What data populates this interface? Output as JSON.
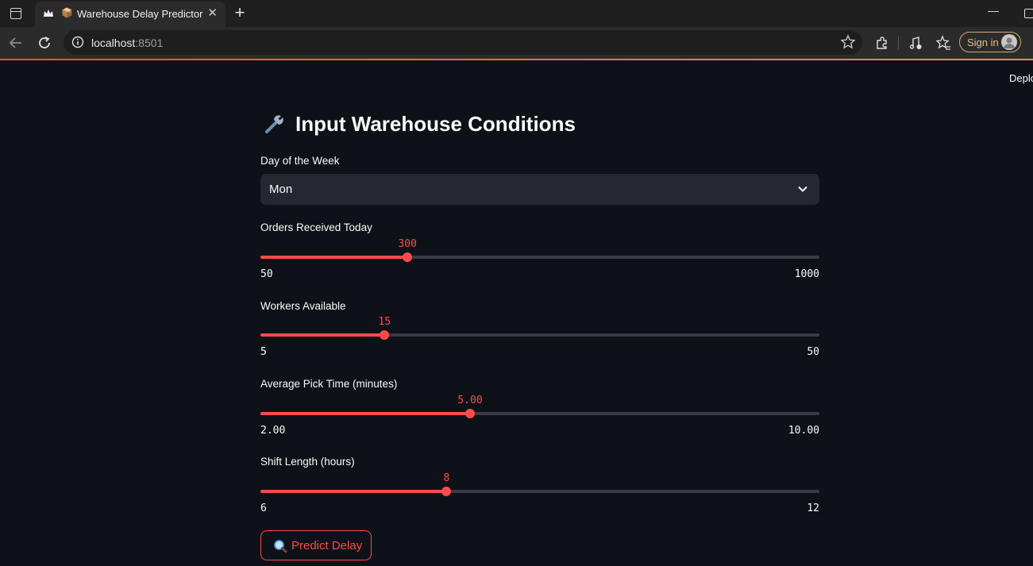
{
  "browser": {
    "tab_title": "Warehouse Delay Predictor",
    "tab_emoji": "📦",
    "url_host": "localhost",
    "url_port": ":8501",
    "signin_label": "Sign in"
  },
  "app": {
    "deploy_label": "Deplo",
    "title": "Input Warehouse Conditions",
    "title_icon": "wrench-icon",
    "accent_color": "#ff4b4b",
    "day_select": {
      "label": "Day of the Week",
      "value": "Mon"
    },
    "sliders": [
      {
        "label": "Orders Received Today",
        "value": "300",
        "min": "50",
        "max": "1000",
        "fraction": 0.263
      },
      {
        "label": "Workers Available",
        "value": "15",
        "min": "5",
        "max": "50",
        "fraction": 0.222
      },
      {
        "label": "Average Pick Time (minutes)",
        "value": "5.00",
        "min": "2.00",
        "max": "10.00",
        "fraction": 0.375
      },
      {
        "label": "Shift Length (hours)",
        "value": "8",
        "min": "6",
        "max": "12",
        "fraction": 0.333
      }
    ],
    "predict_button": {
      "label": "Predict Delay",
      "icon": "magnifier-icon"
    }
  }
}
